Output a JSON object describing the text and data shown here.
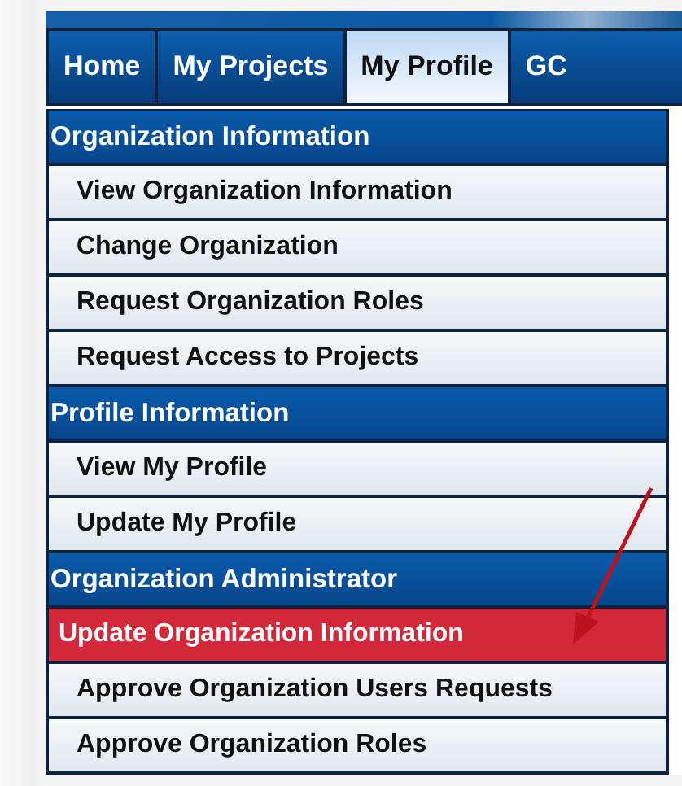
{
  "tabs": [
    {
      "label": "Home",
      "selected": false
    },
    {
      "label": "My Projects",
      "selected": false
    },
    {
      "label": "My Profile",
      "selected": true
    },
    {
      "label": "GC",
      "selected": false
    }
  ],
  "menu": [
    {
      "title": "Organization Information",
      "items": [
        {
          "label": "View Organization Information",
          "selected": false
        },
        {
          "label": "Change Organization",
          "selected": false
        },
        {
          "label": "Request Organization Roles",
          "selected": false
        },
        {
          "label": "Request Access to Projects",
          "selected": false
        }
      ]
    },
    {
      "title": "Profile Information",
      "items": [
        {
          "label": "View My Profile",
          "selected": false
        },
        {
          "label": "Update My Profile",
          "selected": false
        }
      ]
    },
    {
      "title": "Organization Administrator",
      "items": [
        {
          "label": "Update Organization Information",
          "selected": true
        },
        {
          "label": "Approve Organization Users Requests",
          "selected": false
        },
        {
          "label": "Approve Organization Roles",
          "selected": false
        }
      ]
    }
  ]
}
